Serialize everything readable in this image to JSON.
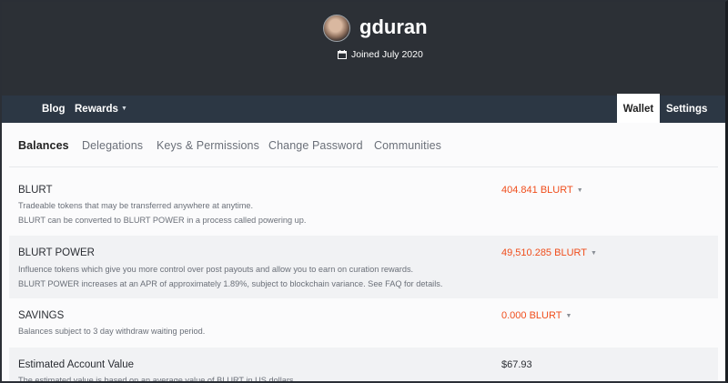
{
  "profile": {
    "username": "gduran",
    "joined": "Joined July 2020"
  },
  "nav": {
    "blog": "Blog",
    "rewards": "Rewards",
    "wallet": "Wallet",
    "settings": "Settings"
  },
  "tabs": {
    "balances": "Balances",
    "delegations": "Delegations",
    "keys": "Keys & Permissions",
    "password": "Change Password",
    "communities": "Communities"
  },
  "rows": {
    "blurt": {
      "title": "BLURT",
      "desc1": "Tradeable tokens that may be transferred anywhere at anytime.",
      "desc2": "BLURT can be converted to BLURT POWER in a process called powering up.",
      "value": "404.841 BLURT"
    },
    "power": {
      "title": "BLURT POWER",
      "desc1": "Influence tokens which give you more control over post payouts and allow you to earn on curation rewards.",
      "desc2": "BLURT POWER increases at an APR of approximately 1.89%, subject to blockchain variance. See FAQ for details.",
      "value": "49,510.285 BLURT"
    },
    "savings": {
      "title": "SAVINGS",
      "desc1": "Balances subject to 3 day withdraw waiting period.",
      "value": "0.000 BLURT"
    },
    "estimated": {
      "title": "Estimated Account Value",
      "desc1": "The estimated value is based on an average value of BLURT in US dollars.",
      "value": "$67.93"
    }
  },
  "colors": {
    "header_bg": "#2c3036",
    "nav_bg": "#2c3744",
    "accent": "#f04e1c"
  },
  "icons": {
    "calendar": "calendar-icon",
    "caret": "caret-down-icon"
  }
}
